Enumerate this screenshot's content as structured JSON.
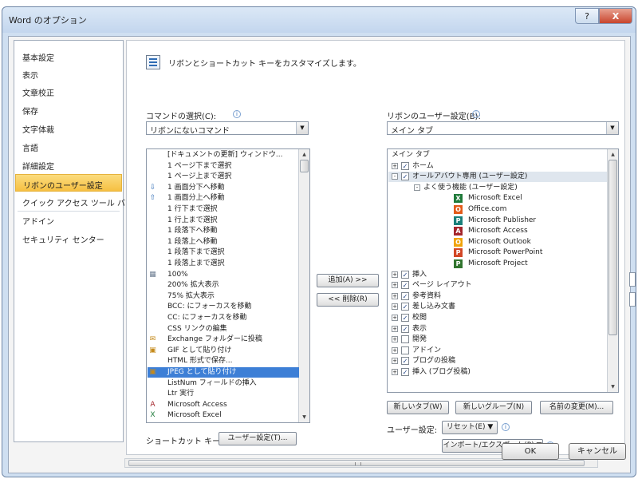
{
  "window": {
    "title": "Word のオプション",
    "help_label": "?",
    "close_label": "X"
  },
  "nav": {
    "items": [
      {
        "label": "基本設定"
      },
      {
        "label": "表示"
      },
      {
        "label": "文章校正"
      },
      {
        "label": "保存"
      },
      {
        "label": "文字体裁"
      },
      {
        "label": "言語"
      },
      {
        "label": "詳細設定"
      },
      {
        "label": "リボンのユーザー設定",
        "selected": true
      },
      {
        "label": "クイック アクセス ツール バー"
      },
      {
        "label": "アドイン"
      },
      {
        "label": "セキュリティ センター"
      }
    ]
  },
  "header": {
    "description": "リボンとショートカット キーをカスタマイズします。"
  },
  "commands": {
    "label": "コマンドの選択(C):",
    "selected": "リボンにないコマンド",
    "items": [
      {
        "label": "[ドキュメントの更新] ウィンドウ...",
        "icon": ""
      },
      {
        "label": "1 ページ下まで選択",
        "icon": ""
      },
      {
        "label": "1 ページ上まで選択",
        "icon": ""
      },
      {
        "label": "1 画面分下へ移動",
        "icon": "arrow-down-icon"
      },
      {
        "label": "1 画面分上へ移動",
        "icon": "arrow-up-icon"
      },
      {
        "label": "1 行下まで選択",
        "icon": ""
      },
      {
        "label": "1 行上まで選択",
        "icon": ""
      },
      {
        "label": "1 段落下へ移動",
        "icon": ""
      },
      {
        "label": "1 段落上へ移動",
        "icon": ""
      },
      {
        "label": "1 段落下まで選択",
        "icon": ""
      },
      {
        "label": "1 段落上まで選択",
        "icon": ""
      },
      {
        "label": "100%",
        "icon": "zoom-icon"
      },
      {
        "label": "200% 拡大表示",
        "icon": ""
      },
      {
        "label": "75% 拡大表示",
        "icon": ""
      },
      {
        "label": "BCC: にフォーカスを移動",
        "icon": ""
      },
      {
        "label": "CC: にフォーカスを移動",
        "icon": ""
      },
      {
        "label": "CSS リンクの編集",
        "icon": ""
      },
      {
        "label": "Exchange フォルダーに投稿",
        "icon": "exchange-icon"
      },
      {
        "label": "GIF として貼り付け",
        "icon": "paste-icon"
      },
      {
        "label": "HTML 形式で保存...",
        "icon": ""
      },
      {
        "label": "JPEG として貼り付け",
        "icon": "paste-icon",
        "selected": true
      },
      {
        "label": "ListNum フィールドの挿入",
        "icon": ""
      },
      {
        "label": "Ltr 実行",
        "icon": ""
      },
      {
        "label": "Microsoft Access",
        "icon": "access-icon"
      },
      {
        "label": "Microsoft Excel",
        "icon": "excel-icon"
      }
    ]
  },
  "ribbon": {
    "label": "リボンのユーザー設定(B):",
    "selected": "メイン タブ",
    "tree": [
      {
        "label": "メイン タブ",
        "level": 0,
        "header": true
      },
      {
        "label": "ホーム",
        "level": 0,
        "expander": "+",
        "checked": true
      },
      {
        "label": "オールアバウト専用 (ユーザー設定)",
        "level": 0,
        "expander": "-",
        "checked": true,
        "highlight": true
      },
      {
        "label": "よく使う機能 (ユーザー設定)",
        "level": 1,
        "expander": "-"
      },
      {
        "label": "Microsoft Excel",
        "level": 2,
        "app": "excel"
      },
      {
        "label": "Office.com",
        "level": 2,
        "app": "office"
      },
      {
        "label": "Microsoft Publisher",
        "level": 2,
        "app": "publisher"
      },
      {
        "label": "Microsoft Access",
        "level": 2,
        "app": "access"
      },
      {
        "label": "Microsoft Outlook",
        "level": 2,
        "app": "outlook"
      },
      {
        "label": "Microsoft PowerPoint",
        "level": 2,
        "app": "powerpoint"
      },
      {
        "label": "Microsoft Project",
        "level": 2,
        "app": "project"
      },
      {
        "label": "挿入",
        "level": 0,
        "expander": "+",
        "checked": true
      },
      {
        "label": "ページ レイアウト",
        "level": 0,
        "expander": "+",
        "checked": true
      },
      {
        "label": "参考資料",
        "level": 0,
        "expander": "+",
        "checked": true
      },
      {
        "label": "差し込み文書",
        "level": 0,
        "expander": "+",
        "checked": true
      },
      {
        "label": "校閲",
        "level": 0,
        "expander": "+",
        "checked": true
      },
      {
        "label": "表示",
        "level": 0,
        "expander": "+",
        "checked": true
      },
      {
        "label": "開発",
        "level": 0,
        "expander": "+",
        "checked": false
      },
      {
        "label": "アドイン",
        "level": 0,
        "expander": "+",
        "checked": false
      },
      {
        "label": "ブログの投稿",
        "level": 0,
        "expander": "+",
        "checked": true
      },
      {
        "label": "挿入 (ブログ投稿)",
        "level": 0,
        "expander": "+",
        "checked": true
      }
    ]
  },
  "buttons": {
    "add": "追加(A) >>",
    "remove": "<< 削除(R)",
    "new_tab": "新しいタブ(W)",
    "new_group": "新しいグループ(N)",
    "rename": "名前の変更(M)...",
    "user_settings_label": "ユーザー設定:",
    "reset": "リセット(E) ▼",
    "import_export": "インポート/エクスポート(P) ▼",
    "shortcut_label": "ショートカット キー:",
    "customize": "ユーザー設定(T)...",
    "ok": "OK",
    "cancel": "キャンセル"
  },
  "colors": {
    "excel": "#1f7a3a",
    "office": "#e35b1a",
    "publisher": "#1a7f7a",
    "access": "#a4262c",
    "outlook": "#f0a30a",
    "powerpoint": "#d24726",
    "project": "#31752f",
    "selection": "#3d7fd6",
    "nav_selected": "#f6c042"
  }
}
